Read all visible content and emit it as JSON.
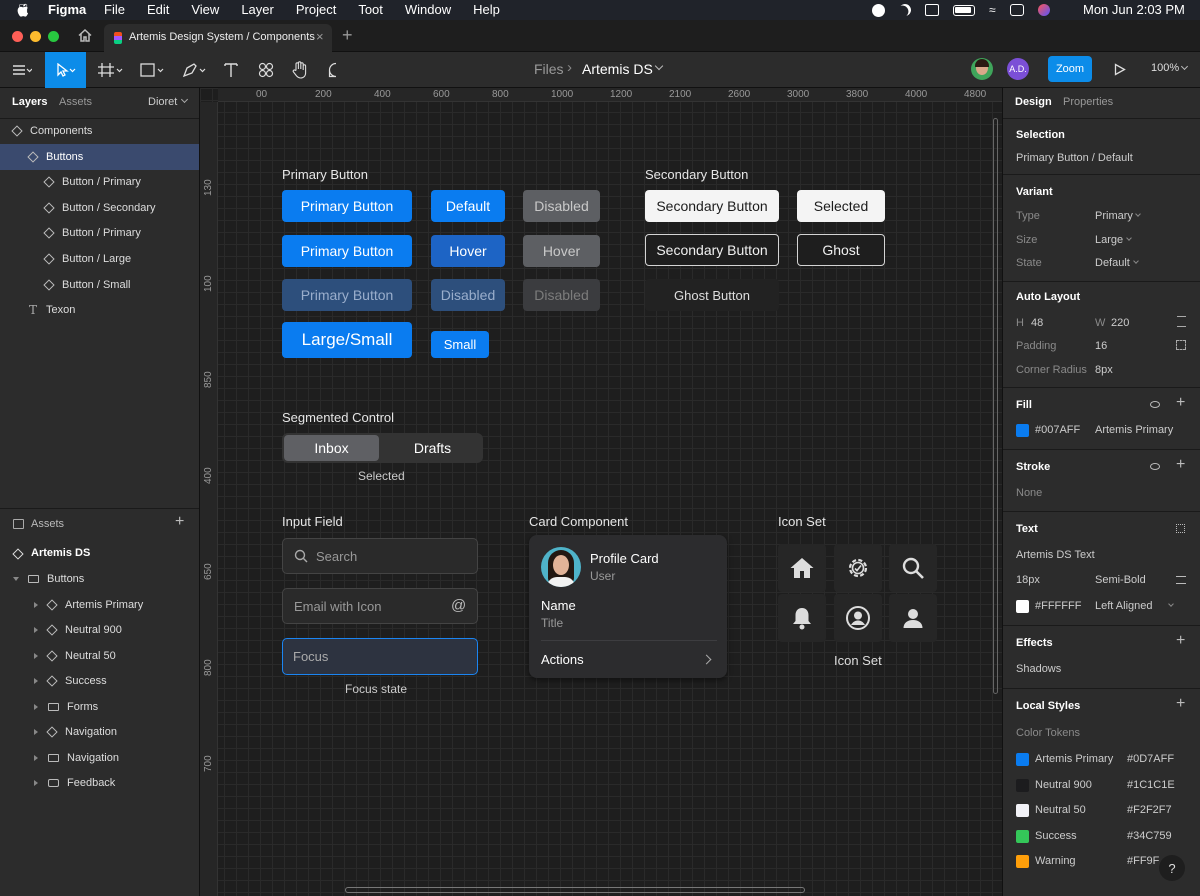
{
  "menubar": {
    "app": "Figma",
    "items": [
      "File",
      "Edit",
      "View",
      "Layer",
      "Project",
      "Toot",
      "Window",
      "Help"
    ],
    "clock": "Mon Jun  2:03 PM"
  },
  "tab": {
    "title": "Artemis Design System / Components"
  },
  "toolbar": {
    "breadcrumb_root": "Files",
    "breadcrumb_sep": "›",
    "file_name": "Artemis DS",
    "avatar_initials": "A.D.",
    "zoom_button": "Zoom",
    "zoom_level": "100%"
  },
  "left": {
    "tabs": [
      "Layers",
      "Assets"
    ],
    "page_select": "Dioret",
    "layers": [
      {
        "label": "Components",
        "kind": "diamond",
        "indent": 0,
        "selected": false
      },
      {
        "label": "Buttons",
        "kind": "diamond",
        "indent": 1,
        "selected": true
      },
      {
        "label": "Button / Primary",
        "kind": "diamond",
        "indent": 2,
        "selected": false
      },
      {
        "label": "Button / Secondary",
        "kind": "diamond",
        "indent": 2,
        "selected": false
      },
      {
        "label": "Button / Primary",
        "kind": "diamond",
        "indent": 2,
        "selected": false
      },
      {
        "label": "Button / Large",
        "kind": "diamond",
        "indent": 2,
        "selected": false
      },
      {
        "label": "Button / Small",
        "kind": "diamond",
        "indent": 2,
        "selected": false
      },
      {
        "label": "Texon",
        "kind": "text",
        "indent": 1,
        "selected": false
      }
    ],
    "assets_title": "Assets",
    "library": "Artemis DS",
    "assets": [
      {
        "label": "Buttons",
        "kind": "folder",
        "expanded": true,
        "indent": 0
      },
      {
        "label": "Artemis Primary",
        "kind": "diamond",
        "indent": 1
      },
      {
        "label": "Neutral 900",
        "kind": "diamond",
        "indent": 1
      },
      {
        "label": "Neutral 50",
        "kind": "diamond",
        "indent": 1
      },
      {
        "label": "Success",
        "kind": "diamond",
        "indent": 1
      },
      {
        "label": "Forms",
        "kind": "folder",
        "indent": 1
      },
      {
        "label": "Navigation",
        "kind": "diamond",
        "indent": 1
      },
      {
        "label": "Navigation",
        "kind": "folder",
        "indent": 1
      },
      {
        "label": "Feedback",
        "kind": "frame",
        "indent": 1
      }
    ]
  },
  "rulers": {
    "h": [
      "00",
      "200",
      "400",
      "600",
      "800",
      "1000",
      "1200",
      "2100",
      "2600",
      "3000",
      "3800",
      "4000",
      "4800"
    ],
    "v": [
      "130",
      "100",
      "850",
      "400",
      "650",
      "800",
      "700"
    ]
  },
  "canvas": {
    "primary": {
      "title": "Primary Button",
      "b1": "Primary Button",
      "b2": "Default",
      "b3": "Disabled",
      "b4": "Primary Button",
      "b5": "Hover",
      "b6": "Hover",
      "b7": "Primary Button",
      "b8": "Disabled",
      "b9": "Disabled",
      "large": "Large/Small",
      "small": "Small"
    },
    "secondary": {
      "title": "Secondary Button",
      "b1": "Secondary Button",
      "b2": "Selected",
      "b3": "Secondary Button",
      "b4": "Ghost",
      "ghost": "Ghost Button"
    },
    "segmented": {
      "title": "Segmented Control",
      "opt1": "Inbox",
      "opt2": "Drafts",
      "caption": "Selected"
    },
    "input": {
      "title": "Input Field",
      "search": "Search",
      "email": "Email with Icon",
      "focus": "Focus",
      "caption": "Focus state"
    },
    "card": {
      "title": "Card Component",
      "name": "Profile Card",
      "role": "User",
      "field_label": "Name",
      "field_value": "Title",
      "action": "Actions"
    },
    "icons": {
      "title": "Icon Set",
      "caption": "Icon Set",
      "list": [
        "home-icon",
        "settings-icon",
        "search-icon",
        "bell-icon",
        "user-circle-icon",
        "user-icon"
      ]
    }
  },
  "right": {
    "tabs": [
      "Design",
      "Properties"
    ],
    "selection_title": "Selection",
    "selection_value": "Primary Button / Default",
    "variant_title": "Variant",
    "variant": [
      {
        "label": "Type",
        "value": "Primary"
      },
      {
        "label": "Size",
        "value": "Large"
      },
      {
        "label": "State",
        "value": "Default"
      }
    ],
    "autolayout_title": "Auto Layout",
    "h_label": "H",
    "h_value": "48",
    "w_label": "W",
    "w_value": "220",
    "padding_label": "Padding",
    "padding_value": "16",
    "radius_label": "Corner Radius",
    "radius_value": "8px",
    "fill_title": "Fill",
    "fill_hex": "#007AFF",
    "fill_name": "Artemis Primary",
    "stroke_title": "Stroke",
    "stroke_value": "None",
    "text_title": "Text",
    "text_style": "Artemis DS Text",
    "text_size": "18px",
    "text_weight": "Semi-Bold",
    "text_color": "#FFFFFF",
    "text_align": "Left Aligned",
    "effects_title": "Effects",
    "effects_value": "Shadows",
    "styles_title": "Local Styles",
    "styles_sub": "Color Tokens",
    "tokens": [
      {
        "name": "Artemis Primary",
        "hex": "#0D7AFF",
        "color": "#0a7cf0"
      },
      {
        "name": "Neutral 900",
        "hex": "#1C1C1E",
        "color": "#1c1c1e"
      },
      {
        "name": "Neutral 50",
        "hex": "#F2F2F7",
        "color": "#f2f2f7"
      },
      {
        "name": "Success",
        "hex": "#34C759",
        "color": "#34c759"
      },
      {
        "name": "Warning",
        "hex": "#FF9F",
        "color": "#ff9f0a"
      }
    ],
    "help": "?"
  }
}
